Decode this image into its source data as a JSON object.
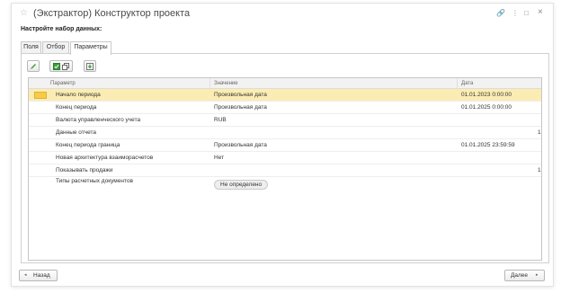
{
  "window": {
    "title": "(Экстрактор) Конструктор проекта",
    "subtitle": "Настройте набор данных:",
    "controls": {
      "link": "🔗",
      "menu": "⋮",
      "minimize": "□",
      "close": "×"
    }
  },
  "tabs": [
    {
      "label": "Поля",
      "active": false
    },
    {
      "label": "Отбор",
      "active": false
    },
    {
      "label": "Параметры",
      "active": true
    }
  ],
  "toolbar": {
    "edit_icon": "pencil-icon",
    "check_icon": "checkbox-checked-icon",
    "copy_icon": "copy-icon",
    "import_icon": "import-icon"
  },
  "table": {
    "columns": [
      "Параметр",
      "Значение",
      "Дата"
    ],
    "rows": [
      {
        "param": "Начало периода",
        "value": "Произвольная дата",
        "date": "01.01.2023 0:00:00",
        "extra": "",
        "selected": true
      },
      {
        "param": "Конец периода",
        "value": "Произвольная дата",
        "date": "01.01.2025 0:00:00",
        "extra": ""
      },
      {
        "param": "Валюта управленческого учета",
        "value": "RUB",
        "date": "",
        "extra": ""
      },
      {
        "param": "Данные отчета",
        "value": "",
        "date": "",
        "extra": "1"
      },
      {
        "param": "Конец периода граница",
        "value": "Произвольная дата",
        "date": "01.01.2025 23:59:59",
        "extra": ""
      },
      {
        "param": "Новая архитектура взаиморасчетов",
        "value": "Нет",
        "date": "",
        "extra": ""
      },
      {
        "param": "Показывать продажи",
        "value": "",
        "date": "",
        "extra": "1"
      },
      {
        "param": "Типы расчетных документов",
        "value_pill": "Не определено",
        "date": "",
        "extra": ""
      }
    ]
  },
  "footer": {
    "back_label": "Назад",
    "next_label": "Далее",
    "back_arrow": "◂",
    "next_arrow": "▸"
  },
  "colors": {
    "selected_row": "#fbecb3",
    "row_marker": "#f6cb45",
    "accent_green": "#3f9b3f"
  }
}
